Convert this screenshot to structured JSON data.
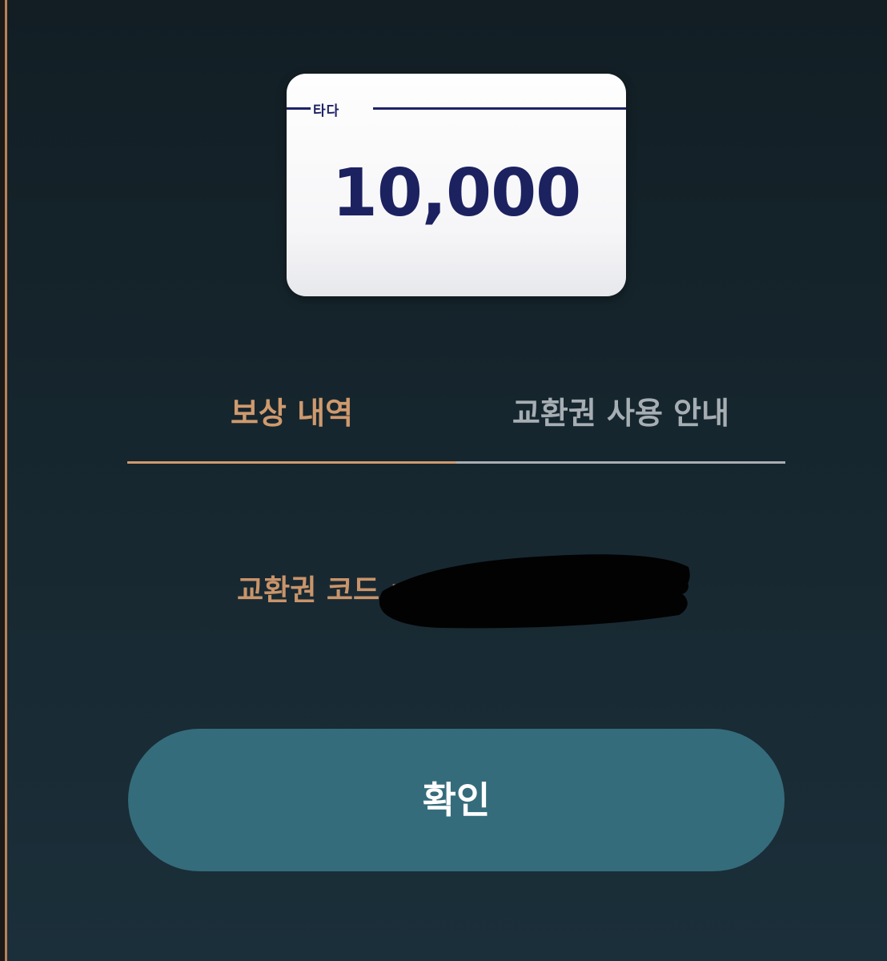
{
  "voucher": {
    "brand": "타다",
    "amount": "10,000"
  },
  "tabs": [
    {
      "label": "보상 내역",
      "active": true
    },
    {
      "label": "교환권 사용 안내",
      "active": false
    }
  ],
  "code": {
    "label": "교환권 코드 :",
    "value_redacted": true
  },
  "confirm": {
    "label": "확인"
  },
  "colors": {
    "accent": "#cf9a6e",
    "button": "#356c7b",
    "card_text": "#1c2260",
    "inactive_tab": "#a6aeb4"
  }
}
